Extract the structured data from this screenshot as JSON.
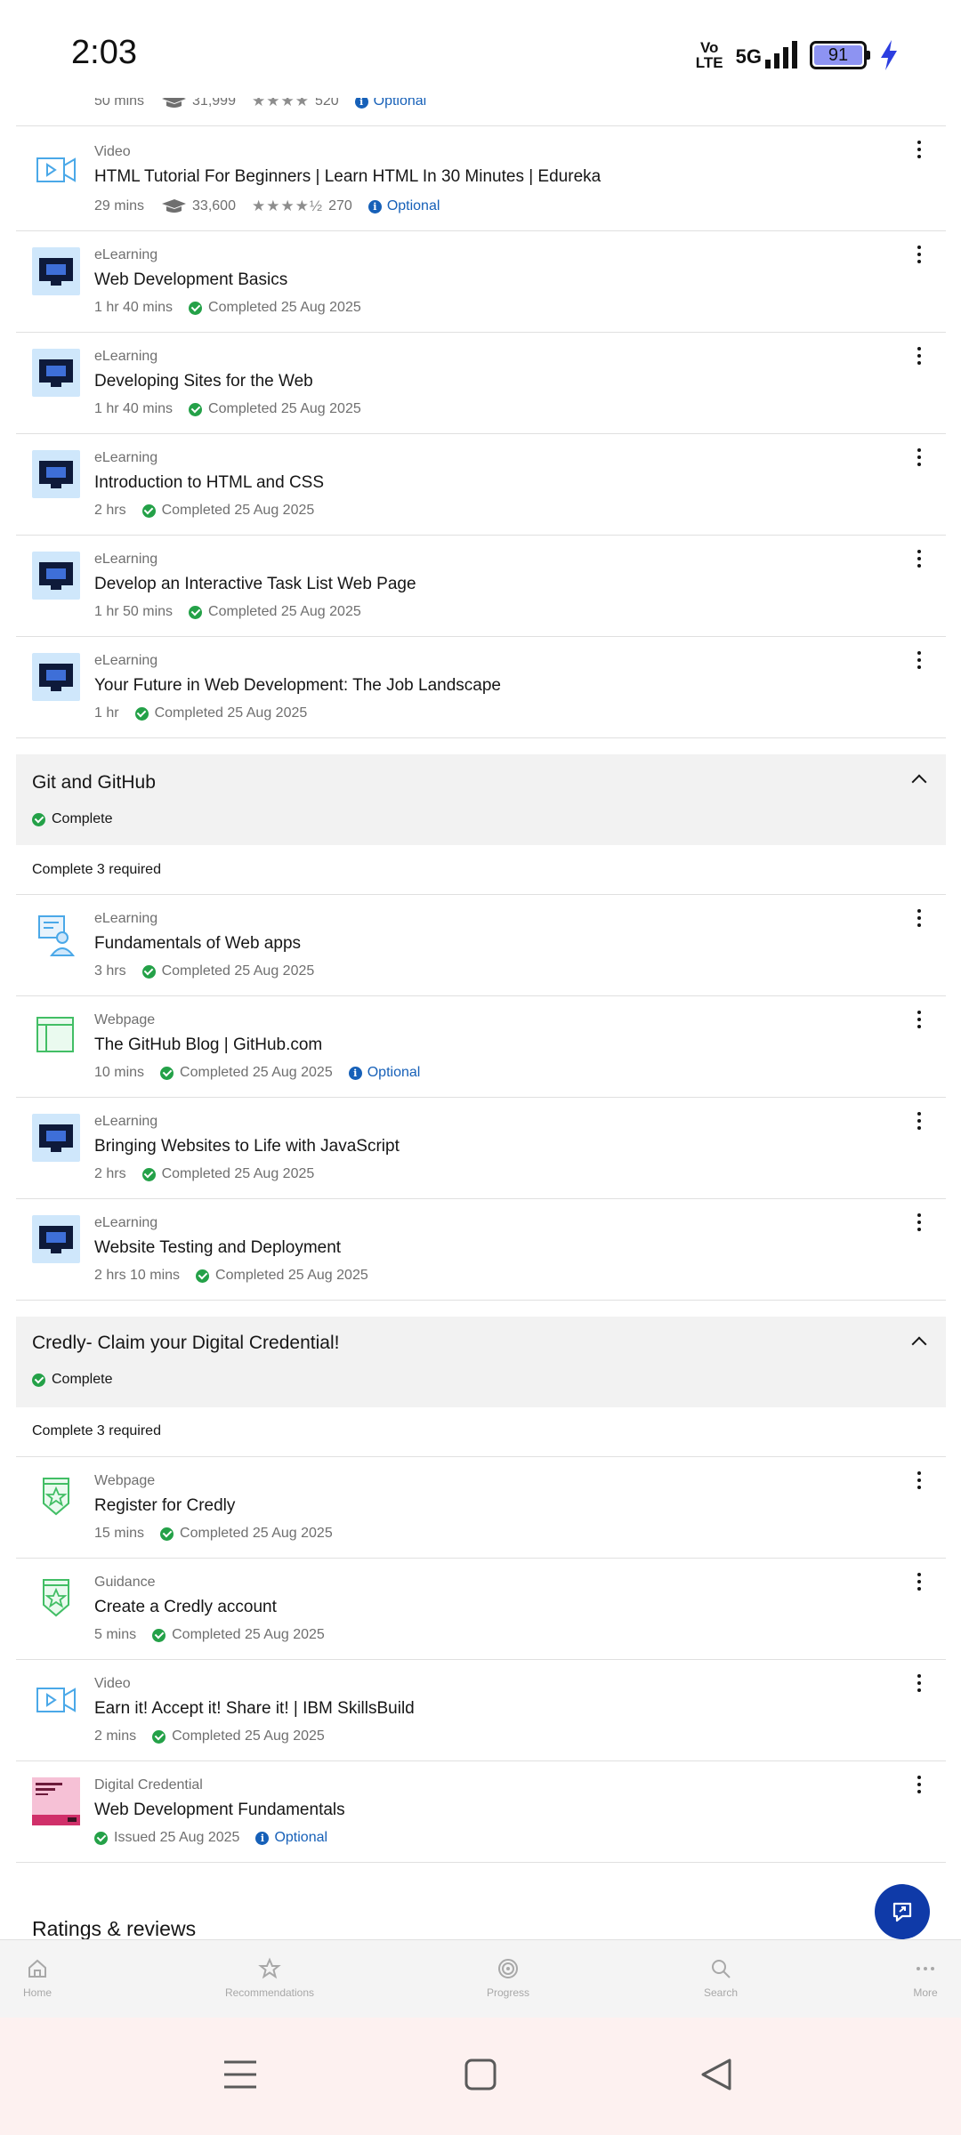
{
  "status_bar": {
    "time": "2:03",
    "network_volte_top": "Vo",
    "network_volte_bottom": "LTE",
    "network_type": "5G",
    "battery": "91"
  },
  "top_partial": {
    "duration": "50 mins",
    "learners": "31,999",
    "stars": "★★★★",
    "rating_count": "520",
    "optional": "Optional"
  },
  "items_top": [
    {
      "type": "Video",
      "title": "HTML Tutorial For Beginners | Learn HTML In 30 Minutes | Edureka",
      "duration": "29 mins",
      "learners": "33,600",
      "stars": "★★★★½",
      "rating_count": "270",
      "optional": "Optional"
    },
    {
      "type": "eLearning",
      "title": "Web Development Basics",
      "duration": "1 hr 40 mins",
      "status": "Completed 25 Aug 2025"
    },
    {
      "type": "eLearning",
      "title": "Developing Sites for the Web",
      "duration": "1 hr 40 mins",
      "status": "Completed 25 Aug 2025"
    },
    {
      "type": "eLearning",
      "title": "Introduction to HTML and CSS",
      "duration": "2 hrs",
      "status": "Completed 25 Aug 2025"
    },
    {
      "type": "eLearning",
      "title": "Develop an Interactive Task List Web Page",
      "duration": "1 hr 50 mins",
      "status": "Completed 25 Aug 2025"
    },
    {
      "type": "eLearning",
      "title": "Your Future in Web Development: The Job Landscape",
      "duration": "1 hr",
      "status": "Completed 25 Aug 2025"
    }
  ],
  "section_git": {
    "title": "Git and GitHub",
    "status": "Complete",
    "required": "Complete 3 required"
  },
  "items_git": [
    {
      "type": "eLearning",
      "title": "Fundamentals of Web apps",
      "duration": "3 hrs",
      "status": "Completed 25 Aug 2025"
    },
    {
      "type": "Webpage",
      "title": "The GitHub Blog | GitHub.com",
      "duration": "10 mins",
      "status": "Completed 25 Aug 2025",
      "optional": "Optional"
    },
    {
      "type": "eLearning",
      "title": "Bringing Websites to Life with JavaScript",
      "duration": "2 hrs",
      "status": "Completed 25 Aug 2025"
    },
    {
      "type": "eLearning",
      "title": "Website Testing and Deployment",
      "duration": "2 hrs 10 mins",
      "status": "Completed 25 Aug 2025"
    }
  ],
  "section_credly": {
    "title": "Credly- Claim your Digital Credential!",
    "status": "Complete",
    "required": "Complete 3 required"
  },
  "items_credly": [
    {
      "type": "Webpage",
      "title": "Register for Credly",
      "duration": "15 mins",
      "status": "Completed 25 Aug 2025"
    },
    {
      "type": "Guidance",
      "title": "Create a Credly account",
      "duration": "5 mins",
      "status": "Completed 25 Aug 2025"
    },
    {
      "type": "Video",
      "title": "Earn it! Accept it! Share it! | IBM SkillsBuild",
      "duration": "2 mins",
      "status": "Completed 25 Aug 2025"
    },
    {
      "type": "Digital Credential",
      "title": "Web Development Fundamentals",
      "status": "Issued 25 Aug 2025",
      "optional": "Optional"
    }
  ],
  "ratings_heading": "Ratings & reviews",
  "bottom_nav": {
    "home": "Home",
    "recommendations": "Recommendations",
    "progress": "Progress",
    "search": "Search",
    "more": "More"
  },
  "colors": {
    "accent": "#0f3aa8",
    "success": "#24a148",
    "link": "#1660b8"
  }
}
